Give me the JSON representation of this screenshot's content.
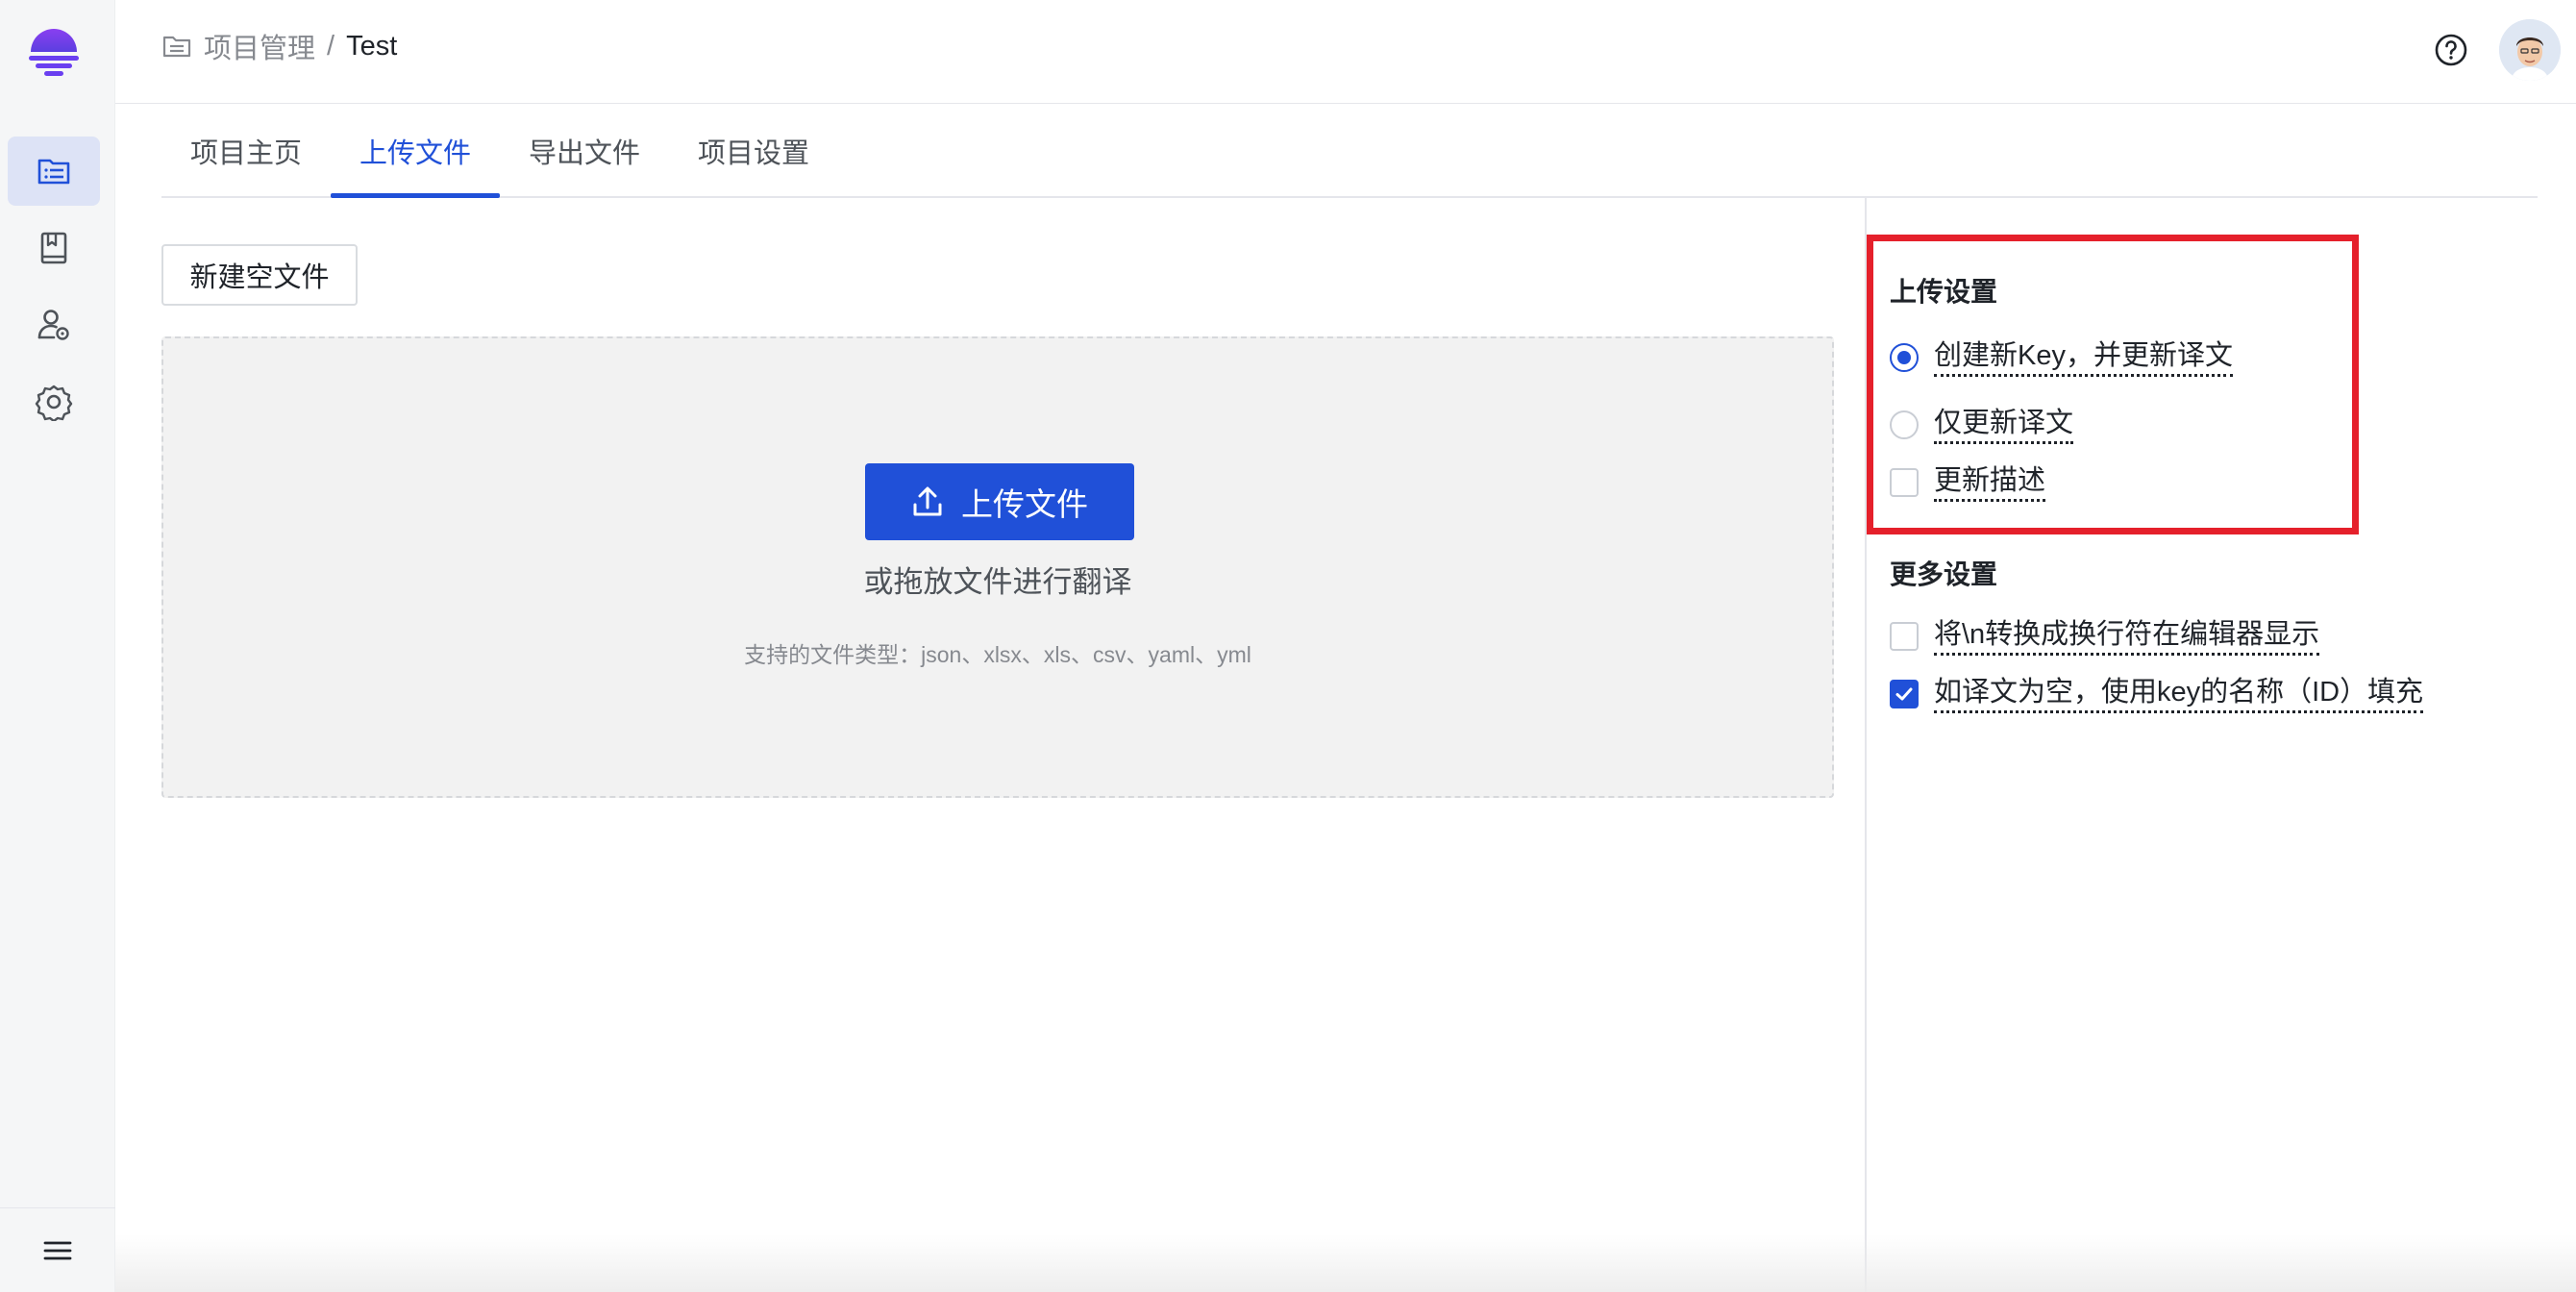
{
  "header": {
    "breadcrumb_parent": "项目管理",
    "breadcrumb_separator": "/",
    "breadcrumb_current": "Test"
  },
  "sidebar": {
    "items": [
      {
        "icon": "project-list-icon",
        "active": true
      },
      {
        "icon": "book-icon",
        "active": false
      },
      {
        "icon": "user-settings-icon",
        "active": false
      },
      {
        "icon": "gear-icon",
        "active": false
      }
    ],
    "footer_icon": "menu-icon"
  },
  "tabs": [
    {
      "label": "项目主页",
      "active": false
    },
    {
      "label": "上传文件",
      "active": true
    },
    {
      "label": "导出文件",
      "active": false
    },
    {
      "label": "项目设置",
      "active": false
    }
  ],
  "toolbar": {
    "new_empty_file": "新建空文件"
  },
  "dropzone": {
    "upload_button": "上传文件",
    "hint": "或拖放文件进行翻译",
    "file_types": "支持的文件类型：json、xlsx、xls、csv、yaml、yml"
  },
  "upload_settings": {
    "title": "上传设置",
    "options": [
      {
        "type": "radio",
        "label": "创建新Key，并更新译文",
        "checked": true
      },
      {
        "type": "radio",
        "label": "仅更新译文",
        "checked": false
      },
      {
        "type": "checkbox",
        "label": "更新描述",
        "checked": false
      }
    ]
  },
  "more_settings": {
    "title": "更多设置",
    "options": [
      {
        "type": "checkbox",
        "label": "将\\n转换成换行符在编辑器显示",
        "checked": false
      },
      {
        "type": "checkbox",
        "label": "如译文为空，使用key的名称（ID）填充",
        "checked": true
      }
    ]
  },
  "colors": {
    "accent": "#2050d8",
    "highlight_border": "#e5202b",
    "sidebar_bg": "#f5f6f7",
    "dropzone_bg": "#f2f2f2"
  }
}
